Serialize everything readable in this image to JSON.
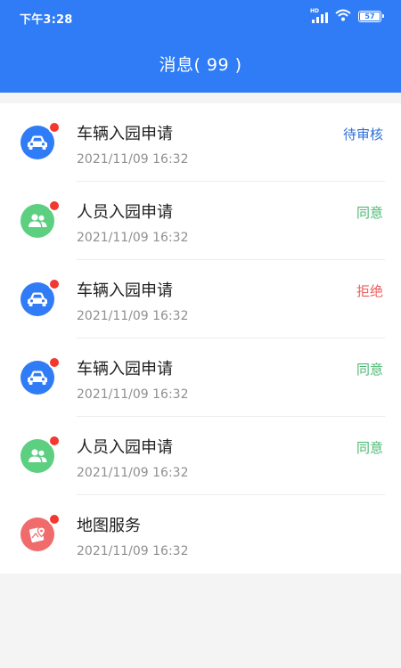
{
  "status_bar": {
    "time": "下午3:28",
    "network_label": "HD",
    "battery_level": "57"
  },
  "header": {
    "title": "消息( 99 )"
  },
  "messages": [
    {
      "icon": "car-icon",
      "title": "车辆入园申请",
      "time": "2021/11/09 16:32",
      "status": "待审核",
      "status_kind": "pending",
      "unread": true
    },
    {
      "icon": "people-icon",
      "title": "人员入园申请",
      "time": "2021/11/09 16:32",
      "status": "同意",
      "status_kind": "agree",
      "unread": true
    },
    {
      "icon": "car-icon",
      "title": "车辆入园申请",
      "time": "2021/11/09 16:32",
      "status": "拒绝",
      "status_kind": "reject",
      "unread": true
    },
    {
      "icon": "car-icon",
      "title": "车辆入园申请",
      "time": "2021/11/09 16:32",
      "status": "同意",
      "status_kind": "agree",
      "unread": true
    },
    {
      "icon": "people-icon",
      "title": "人员入园申请",
      "time": "2021/11/09 16:32",
      "status": "同意",
      "status_kind": "agree",
      "unread": true
    },
    {
      "icon": "map-icon",
      "title": "地图服务",
      "time": "2021/11/09 16:32",
      "status": "",
      "status_kind": "none",
      "unread": true
    }
  ],
  "colors": {
    "header_bg": "#2f7cf6",
    "car_icon_bg": "#2f7cf6",
    "people_icon_bg": "#5ccf81",
    "map_icon_bg": "#f06c6c",
    "badge": "#f2382f",
    "pending": "#2f6fd6",
    "agree": "#4cb872",
    "reject": "#ef5b5b"
  }
}
